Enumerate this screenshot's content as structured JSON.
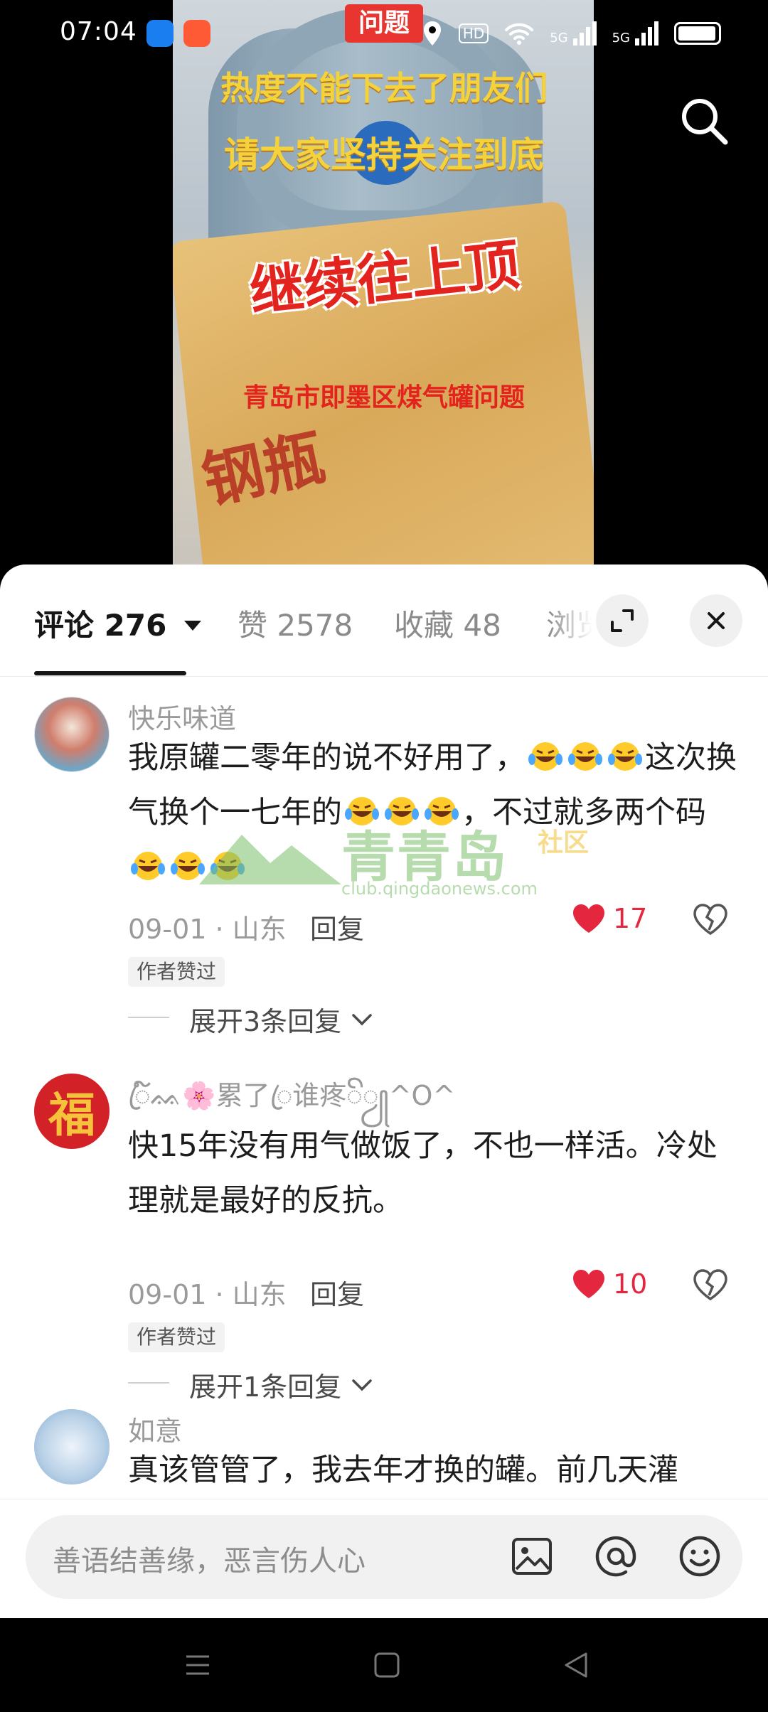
{
  "status_bar": {
    "time": "07:04",
    "hd_label": "HD",
    "net_label_1": "5G",
    "net_label_2": "5G"
  },
  "video": {
    "tag": "问题",
    "caption_line1": "热度不能下去了朋友们",
    "caption_line2": "请大家坚持关注到底",
    "caption_big": "继续往上顶",
    "caption_sub": "青岛市即墨区煤气罐问题",
    "bag_text": "钢瓶"
  },
  "tabs": {
    "comments_label": "评论 276",
    "likes_label": "赞 2578",
    "favorites_label": "收藏 48",
    "views_label": "浏览"
  },
  "comments": [
    {
      "name": "快乐味道",
      "text_parts": [
        "我原罐二零年的说不好用了，",
        "这次换气换个一七年的",
        "，不过就多两个码"
      ],
      "date_location": "09-01 · 山东",
      "reply_label": "回复",
      "likes": "17",
      "badge": "作者赞过",
      "expand_label": "展开3条回复"
    },
    {
      "name": "ꦿ໌ᨐ🌸累了ꦿ谁疼ꦼꦾ^O^",
      "text": "快15年没有用气做饭了，不也一样活。冷处理就是最好的反抗。",
      "date_location": "09-01 · 山东",
      "reply_label": "回复",
      "likes": "10",
      "badge": "作者赞过",
      "expand_label": "展开1条回复",
      "avatar_char": "福"
    },
    {
      "name": "如意",
      "text": "真该管管了，我去年才换的罐。前几天灌"
    }
  ],
  "watermark": {
    "title": "青青岛",
    "subtitle": "社区",
    "url": "club.qingdaonews.com"
  },
  "input": {
    "placeholder": "善语结善缘，恶言伤人心"
  },
  "icons": {
    "search": "search-icon",
    "expand": "expand-icon",
    "close": "close-icon",
    "heart": "heart-icon",
    "broken_heart": "broken-heart-icon",
    "image": "image-icon",
    "at": "at-icon",
    "emoji": "emoji-icon",
    "menu": "menu-icon",
    "home": "home-icon",
    "back": "back-icon"
  },
  "colors": {
    "like_red": "#e4263f",
    "caption_yellow": "#f4d23b",
    "caption_red": "#e3231d"
  }
}
